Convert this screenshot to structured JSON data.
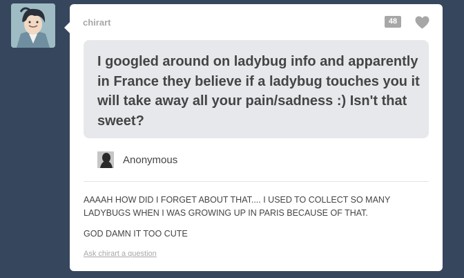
{
  "post": {
    "username": "chirart",
    "notes_count": "48",
    "question": "I googled around on ladybug info and apparently in France they believe if a ladybug touches you it will take away all your pain/sadness :) Isn't that sweet?",
    "asker_name": "Anonymous",
    "answer_paragraphs": [
      "AAAAH HOW DID I FORGET ABOUT THAT.... I USED TO COLLECT SO MANY LADYBUGS WHEN I WAS GROWING UP IN PARIS BECAUSE OF THAT.",
      "GOD DAMN IT TOO CUTE"
    ],
    "ask_link": "Ask chirart a question"
  },
  "colors": {
    "background": "#36465d",
    "card": "#ffffff",
    "question_bubble": "#e6e8eb",
    "muted": "#a7a7a7"
  },
  "icons": {
    "like": "heart-icon",
    "blog_avatar": "avatar",
    "asker_avatar": "anonymous-silhouette-icon"
  }
}
